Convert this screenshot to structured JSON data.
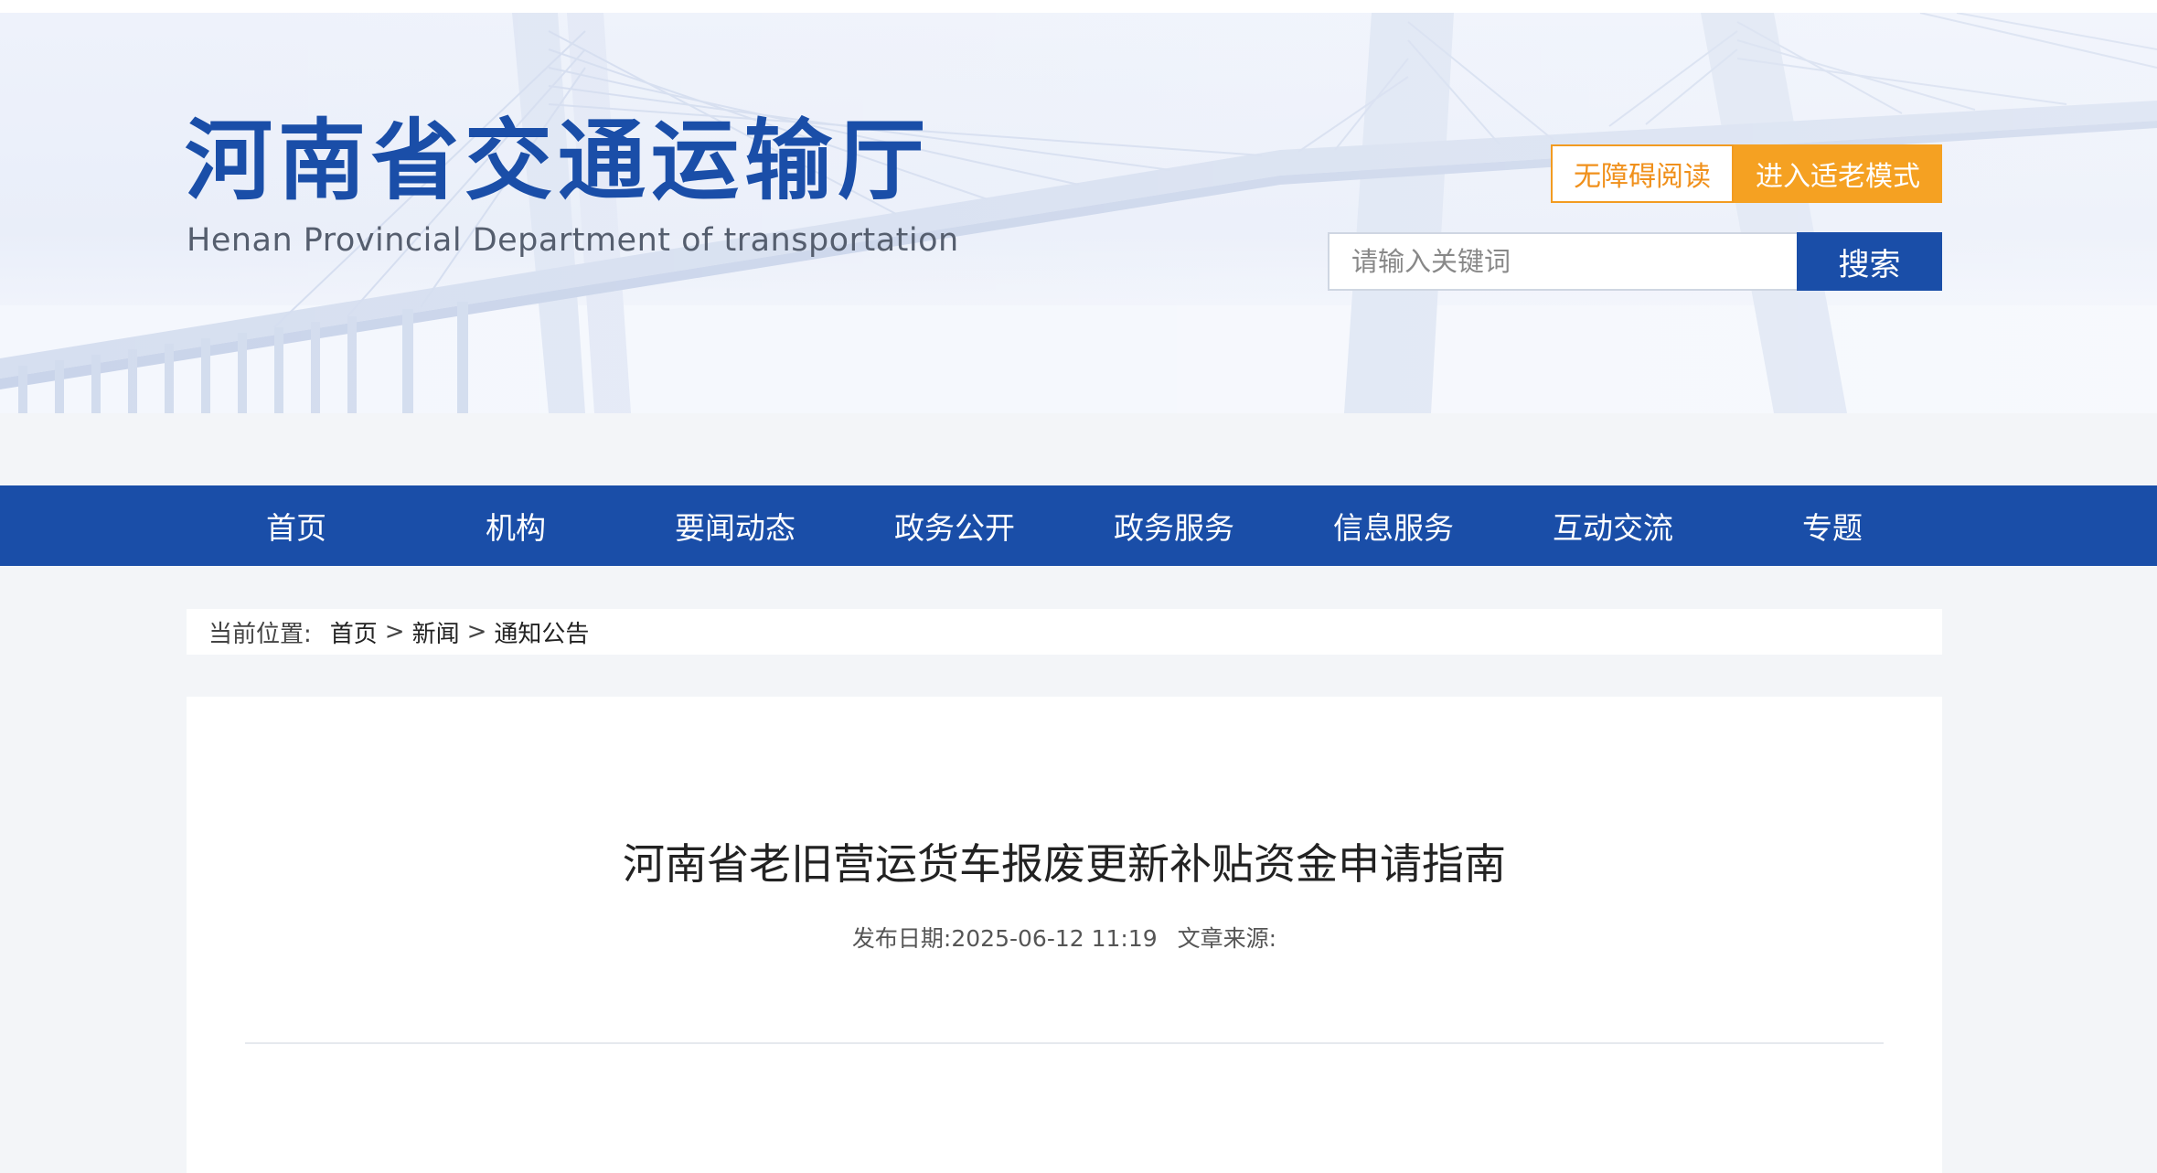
{
  "header": {
    "logo_cn": "河南省交通运输厅",
    "logo_en": "Henan Provincial Department of transportation",
    "accessibility_label": "无障碍阅读",
    "elder_mode_label": "进入适老模式",
    "search_placeholder": "请输入关键词",
    "search_button_label": "搜索"
  },
  "nav": {
    "items": [
      {
        "label": "首页"
      },
      {
        "label": "机构"
      },
      {
        "label": "要闻动态"
      },
      {
        "label": "政务公开"
      },
      {
        "label": "政务服务"
      },
      {
        "label": "信息服务"
      },
      {
        "label": "互动交流"
      },
      {
        "label": "专题"
      }
    ]
  },
  "breadcrumb": {
    "label": "当前位置:",
    "items": [
      "首页",
      "新闻",
      "通知公告"
    ],
    "separator": ">"
  },
  "article": {
    "title": "河南省老旧营运货车报废更新补贴资金申请指南",
    "publish_label": "发布日期:",
    "publish_datetime": "2025-06-12 11:19",
    "source_label": "文章来源:"
  },
  "colors": {
    "primary_blue": "#1a4ea8",
    "accent_orange": "#f5a122",
    "page_background": "#f3f5f8"
  }
}
